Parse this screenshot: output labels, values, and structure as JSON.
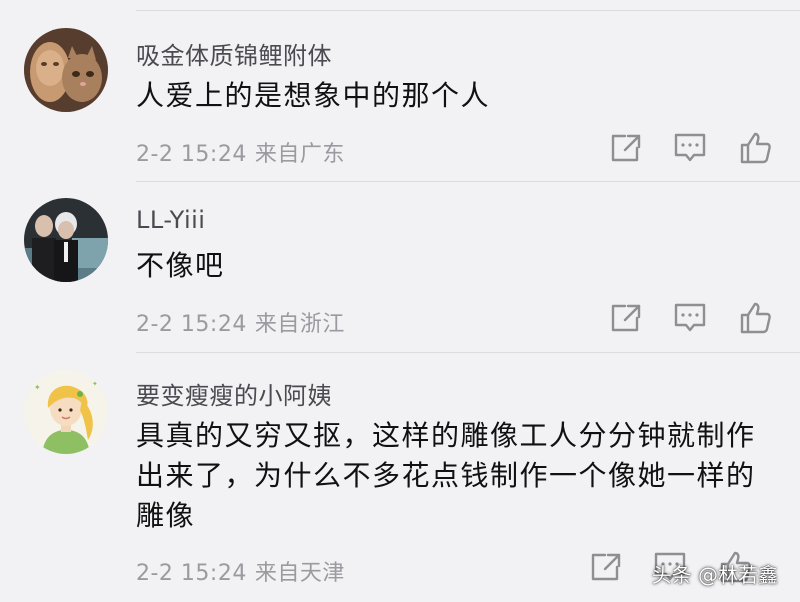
{
  "colors": {
    "background": "#f2f2f4",
    "username": "#4a4a50",
    "text": "#111111",
    "meta": "#9a9aa0",
    "icon": "#8e8e93"
  },
  "comments": [
    {
      "username": "吸金体质锦鲤附体",
      "text": "人爱上的是想象中的那个人",
      "time": "2-2 15:24",
      "location": "来自广东",
      "avatar_icon": "cat-mask-avatar"
    },
    {
      "username": "LL-Yiii",
      "text": "不像吧",
      "time": "2-2 15:24",
      "location": "来自浙江",
      "avatar_icon": "photo-avatar"
    },
    {
      "username": "要变瘦瘦的小阿姨",
      "text_lines": [
        "具真的又穷又抠，这样的雕像工人分分钟就制作",
        "出来了，为什么不多花点钱制作一个像她一样的",
        "雕像"
      ],
      "time": "2-2 15:24",
      "location": "来自天津",
      "avatar_icon": "cartoon-girl-avatar"
    }
  ],
  "actions": {
    "share_icon": "share-icon",
    "reply_icon": "comment-icon",
    "like_icon": "thumbs-up-icon"
  },
  "watermark": "头条 @林若鑫"
}
